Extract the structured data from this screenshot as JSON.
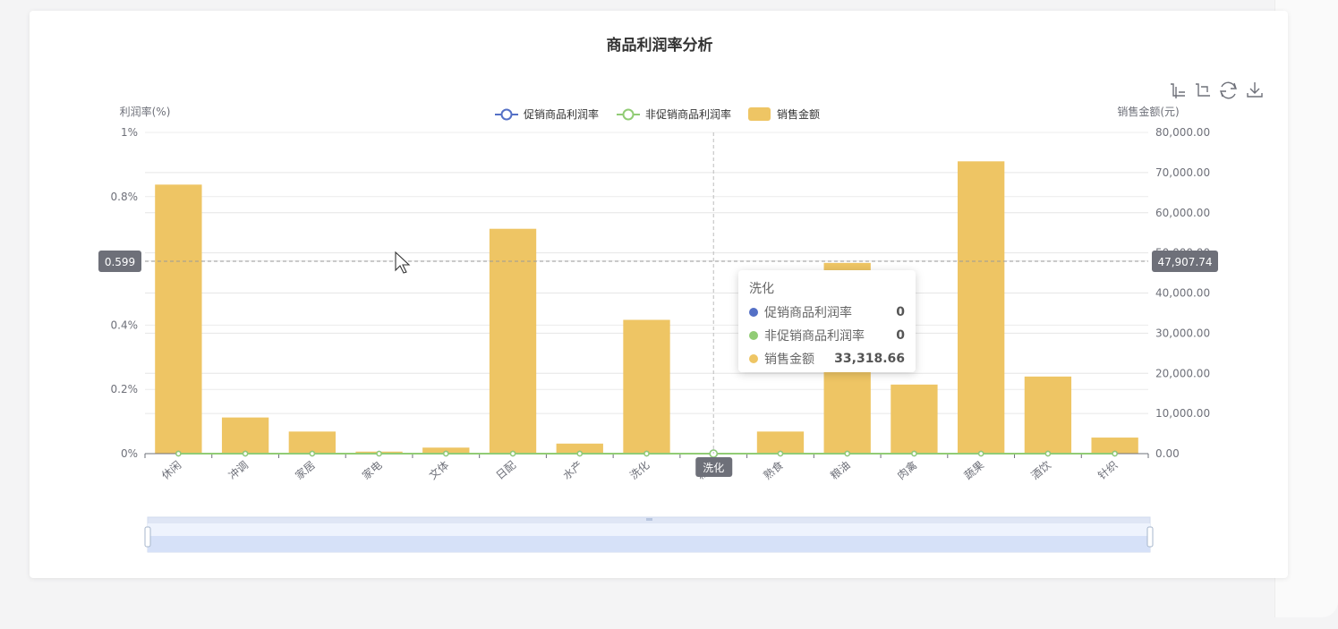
{
  "colors": {
    "promo": "#5470c6",
    "nonpromo": "#91cc75",
    "sales": "#eec564",
    "axis_text": "#6e7079",
    "grid": "#e6e6e6"
  },
  "toolbox": [
    "crop-icon",
    "crop-back-icon",
    "refresh-icon",
    "download-icon"
  ],
  "tooltip": {
    "title": "洗化",
    "rows": [
      {
        "name": "促销商品利润率",
        "value": "0",
        "color": "#5470c6"
      },
      {
        "name": "非促销商品利润率",
        "value": "0",
        "color": "#91cc75"
      },
      {
        "name": "销售金额",
        "value": "33,318.66",
        "color": "#eec564"
      }
    ]
  },
  "pointer": {
    "left_value": 0.599,
    "left_label": "0.599",
    "right_label": "47,907.74",
    "category_label": "洗化"
  },
  "chart_data": {
    "type": "bar",
    "title": "商品利润率分析",
    "categories": [
      "休闲",
      "冲调",
      "家居",
      "家电",
      "文体",
      "日配",
      "水产",
      "洗化",
      "粮油",
      "熟食",
      "粮油",
      "肉禽",
      "蔬果",
      "酒饮",
      "针织"
    ],
    "series": [
      {
        "name": "促销商品利润率",
        "type": "line",
        "axis": "left",
        "values": [
          0,
          0,
          0,
          0,
          0,
          0,
          0,
          0,
          0,
          0,
          0,
          0,
          0,
          0,
          0
        ]
      },
      {
        "name": "非促销商品利润率",
        "type": "line",
        "axis": "left",
        "values": [
          0,
          0,
          0,
          0,
          0,
          0,
          0,
          0,
          0,
          0,
          0,
          0,
          0,
          0,
          0
        ]
      },
      {
        "name": "销售金额",
        "type": "bar",
        "axis": "right",
        "values": [
          67000,
          9000,
          5500,
          500,
          1500,
          56000,
          2500,
          33318.66,
          0,
          5500,
          47500,
          17200,
          72800,
          19200,
          4000
        ]
      }
    ],
    "ylabel_left": "利润率(%)",
    "ylabel_right": "销售金额(元)",
    "left_ticks": [
      "0%",
      "0.2%",
      "0.4%",
      "",
      "0.8%",
      "1%"
    ],
    "right_ticks": [
      "0.00",
      "10,000.00",
      "20,000.00",
      "30,000.00",
      "40,000.00",
      "50,000.00",
      "60,000.00",
      "70,000.00",
      "80,000.00"
    ],
    "ylim_left": [
      0,
      1
    ],
    "ylim_right": [
      0,
      80000
    ],
    "legend": "top-center",
    "grid": true
  }
}
